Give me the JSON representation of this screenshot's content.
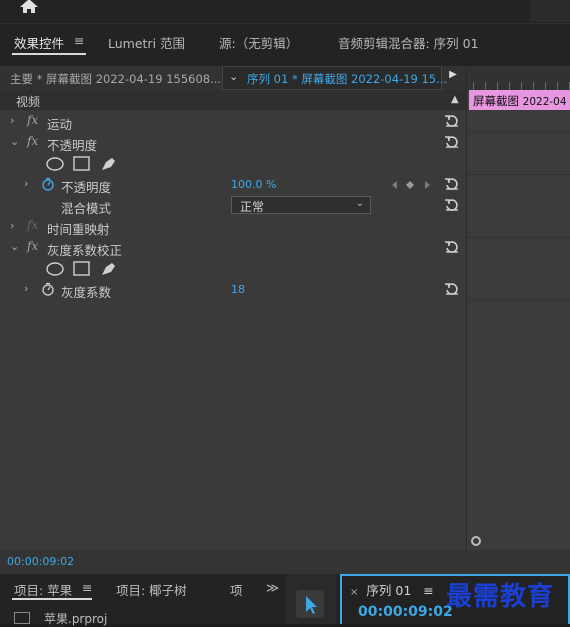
{
  "tabs": {
    "effect_controls": "效果控件",
    "menu_glyph": "≡",
    "lumetri": "Lumetri 范围",
    "source": "源:（无剪辑）",
    "audio_mixer": "音频剪辑混合器: 序列 01"
  },
  "source_bar": {
    "master": "主要 * 屏幕截图 2022-04-19 155608...",
    "sequence": "序列 01 * 屏幕截图 2022-04-19 15..."
  },
  "timeline_clip": {
    "name": "屏幕截图",
    "date": "2022-04"
  },
  "section": {
    "title": "视频"
  },
  "effects": [
    {
      "label": "运动"
    },
    {
      "label": "不透明度"
    },
    {
      "label": "不透明度",
      "value": "100.0 %"
    },
    {
      "label": "混合模式",
      "value": "正常"
    },
    {
      "label": "时间重映射"
    },
    {
      "label": "灰度系数校正"
    },
    {
      "label": "灰度系数",
      "value": "18"
    }
  ],
  "timecode": "00:00:09:02",
  "bottom": {
    "project_tab": "项目: 苹果",
    "project_tab_menu": "≡",
    "project_tab2": "项目: 椰子树",
    "project_tab3": "项",
    "more": "≫",
    "project_file": "苹果.prproj",
    "sequence_tab": "序列 01",
    "sequence_menu": "≡",
    "sequence_timecode": "00:00:09:02"
  },
  "watermark": "最需教育",
  "colors": {
    "accent_blue": "#3ea8e6",
    "clip_pink": "#e796e0",
    "panel_bg": "#3a3a3a"
  }
}
